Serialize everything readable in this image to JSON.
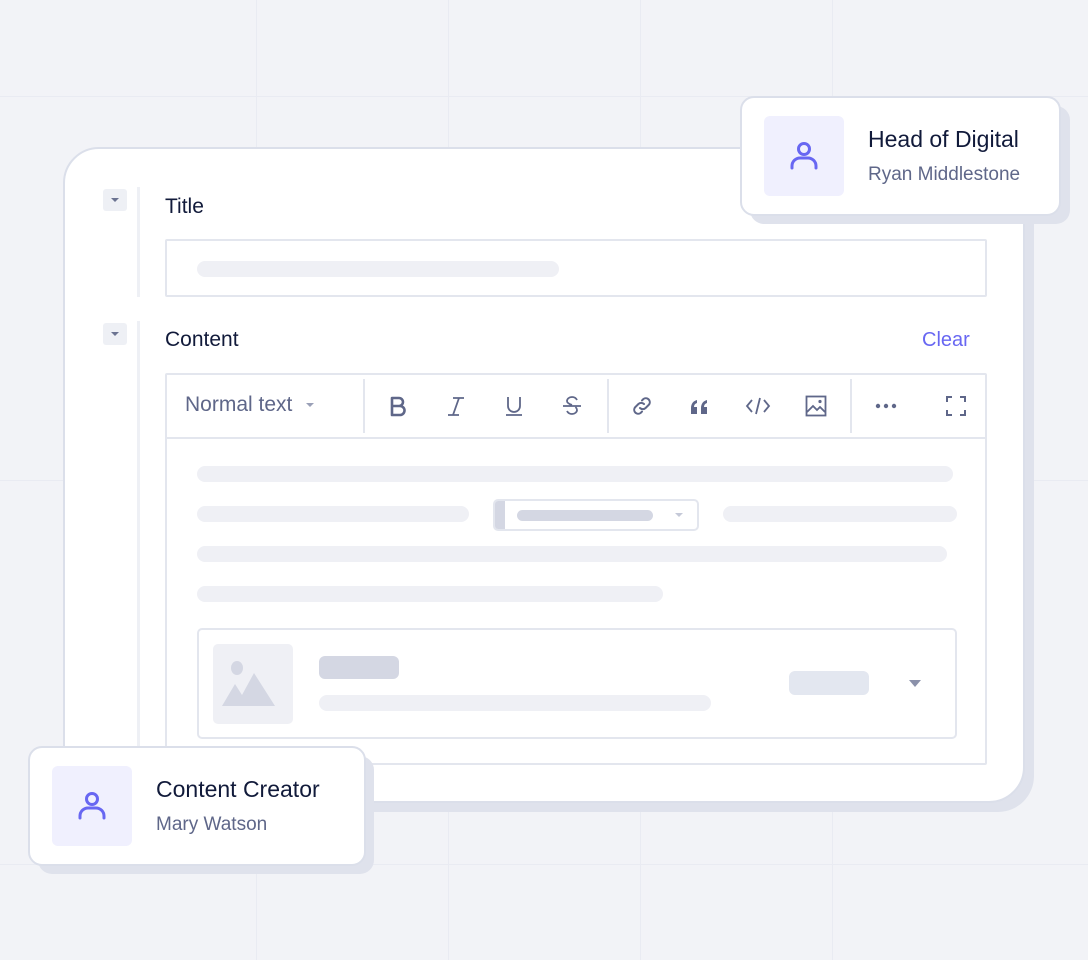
{
  "colors": {
    "background": "#f2f3f7",
    "accent": "#6867f2",
    "heading_text": "#111a3a",
    "muted_text": "#5f6789",
    "skeleton": "#eff0f5",
    "skeleton_dark": "#d4d7e3",
    "avatar_bg": "#f0f0fe"
  },
  "form": {
    "fields": [
      {
        "label": "Title",
        "collapse_icon": "caret-down-icon"
      },
      {
        "label": "Content",
        "collapse_icon": "caret-down-icon",
        "action": "Clear"
      }
    ]
  },
  "editor": {
    "toolbar": {
      "text_style": {
        "selected": "Normal text",
        "icon": "caret-down-icon"
      },
      "buttons": [
        {
          "name": "bold",
          "icon": "bold-icon"
        },
        {
          "name": "italic",
          "icon": "italic-icon"
        },
        {
          "name": "underline",
          "icon": "underline-icon"
        },
        {
          "name": "strikethrough",
          "icon": "strikethrough-icon"
        },
        {
          "name": "link",
          "icon": "link-icon"
        },
        {
          "name": "quote",
          "icon": "quote-icon"
        },
        {
          "name": "code",
          "icon": "code-icon"
        },
        {
          "name": "image",
          "icon": "image-icon"
        },
        {
          "name": "more",
          "icon": "more-icon"
        },
        {
          "name": "fullscreen",
          "icon": "fullscreen-icon"
        }
      ]
    }
  },
  "roles": [
    {
      "title": "Head of Digital",
      "name": "Ryan Middlestone",
      "icon": "user-icon"
    },
    {
      "title": "Content Creator",
      "name": "Mary Watson",
      "icon": "user-icon"
    }
  ]
}
